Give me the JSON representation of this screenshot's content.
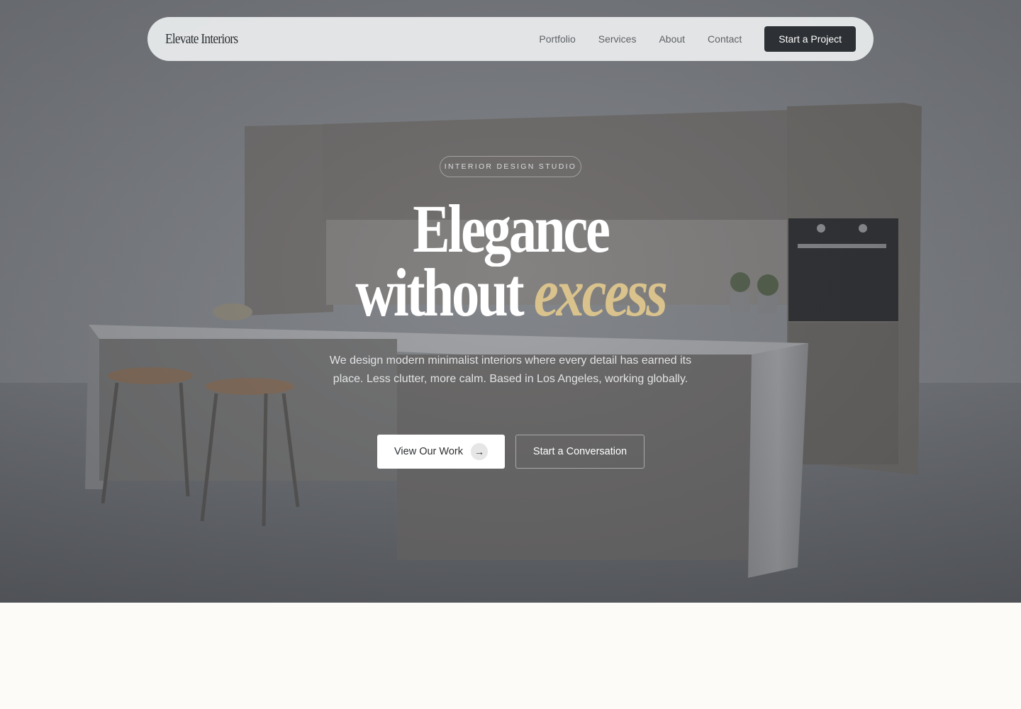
{
  "nav": {
    "brand": "Elevate Interiors",
    "links": [
      "Portfolio",
      "Services",
      "About",
      "Contact"
    ],
    "cta": "Start a Project"
  },
  "hero": {
    "badge": "INTERIOR DESIGN STUDIO",
    "headline_line1": "Elegance",
    "headline_line2_plain": "without",
    "headline_line2_accent": "excess",
    "subtitle": "We design modern minimalist interiors where every detail has earned its place. Less clutter, more calm. Based in Los Angeles, working globally.",
    "primary_button": "View Our Work",
    "primary_button_icon": "arrow-right-icon",
    "secondary_button": "Start a Conversation"
  },
  "colors": {
    "accent_gold": "#d9c28c",
    "dark": "#2d3034",
    "page_bg": "#fcfbf8"
  }
}
